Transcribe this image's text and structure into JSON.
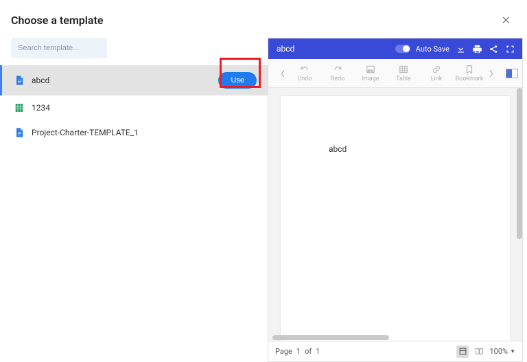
{
  "header": {
    "title": "Choose a template"
  },
  "search": {
    "placeholder": "Search template..."
  },
  "templates": [
    {
      "name": "abcd",
      "icon": "doc-blue",
      "selected": true
    },
    {
      "name": "1234",
      "icon": "sheet-green",
      "selected": false
    },
    {
      "name": "Project-Charter-TEMPLATE_1",
      "icon": "doc-blue",
      "selected": false
    }
  ],
  "use_button": "Use",
  "preview": {
    "doc_title": "abcd",
    "autosave_label": "Auto Save",
    "toolbar": {
      "undo": "Undo",
      "redo": "Redo",
      "image": "Image",
      "table": "Table",
      "link": "Link",
      "bookmark": "Bookmark"
    },
    "content": "abcd",
    "status": {
      "page_label": "Page",
      "current": "1",
      "of": "of",
      "total": "1",
      "zoom": "100%"
    }
  }
}
